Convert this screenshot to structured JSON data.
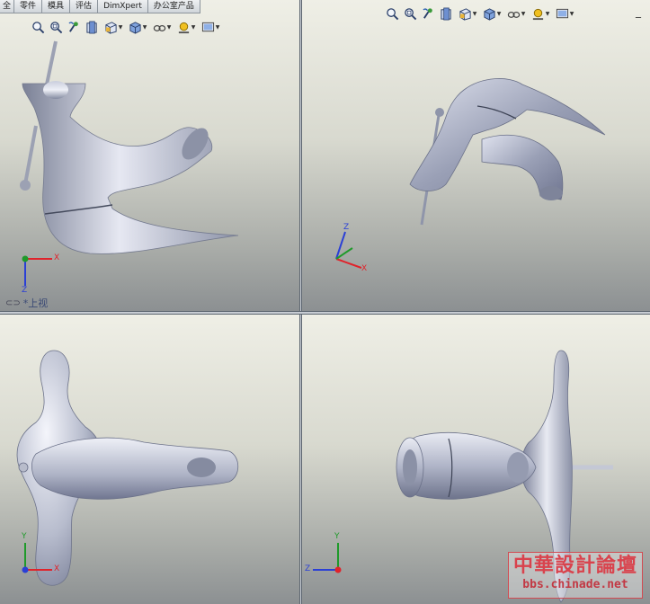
{
  "ribbon_tabs": [
    "全",
    "零件",
    "模具",
    "评估",
    "DimXpert",
    "办公室产品"
  ],
  "toolbar_icons": [
    {
      "name": "zoom-to-fit-icon",
      "dropdown": false
    },
    {
      "name": "zoom-to-area-icon",
      "dropdown": false
    },
    {
      "name": "previous-view-icon",
      "dropdown": false
    },
    {
      "name": "section-view-icon",
      "dropdown": false
    },
    {
      "name": "view-orientation-icon",
      "dropdown": true
    },
    {
      "name": "display-style-icon",
      "dropdown": true
    },
    {
      "name": "hide-show-items-icon",
      "dropdown": true
    },
    {
      "name": "edit-appearance-icon",
      "dropdown": true
    },
    {
      "name": "apply-scene-icon",
      "dropdown": true
    }
  ],
  "viewport_top_left": {
    "view_label": "*上视"
  },
  "triad_labels": {
    "x": "X",
    "y": "Y",
    "z": "Z"
  },
  "window_button": "_",
  "watermark": {
    "title": "中華設計論壇",
    "url": "bbs.chinade.net"
  },
  "colors": {
    "axis_x": "#e0232b",
    "axis_y": "#1f9a2a",
    "axis_z": "#2a3fd6",
    "model_shade": "#aeb3c8"
  }
}
